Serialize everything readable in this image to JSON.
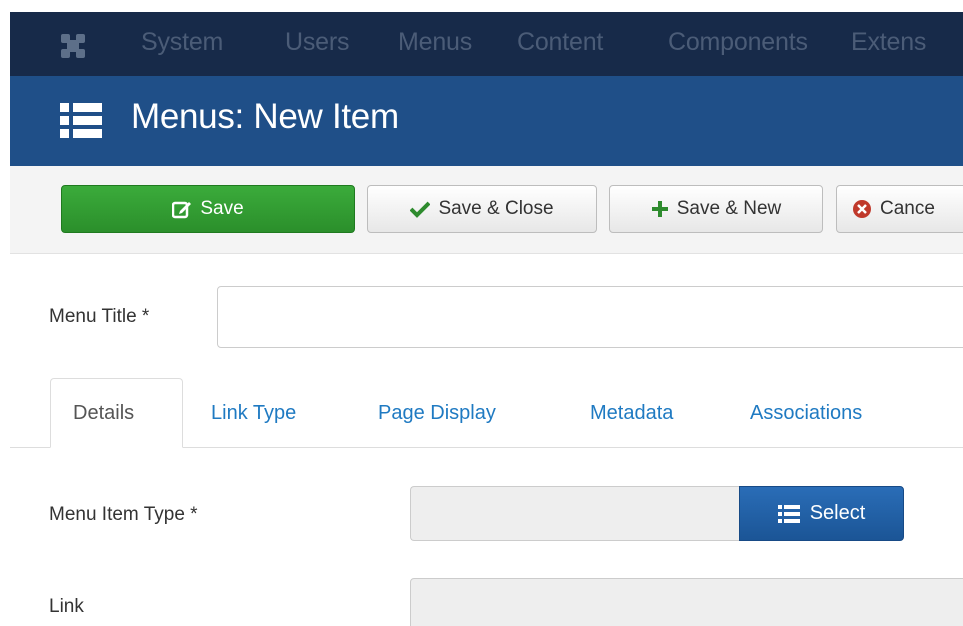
{
  "topnav": {
    "logo_icon": "joomla-logo-icon",
    "items": [
      {
        "label": "System"
      },
      {
        "label": "Users"
      },
      {
        "label": "Menus"
      },
      {
        "label": "Content"
      },
      {
        "label": "Components"
      },
      {
        "label": "Extens"
      }
    ]
  },
  "header": {
    "icon": "list-icon",
    "title": "Menus: New Item"
  },
  "toolbar": {
    "save_label": "Save",
    "save_close_label": "Save & Close",
    "save_new_label": "Save & New",
    "cancel_label": "Cance"
  },
  "form": {
    "menu_title_label": "Menu Title *",
    "menu_title_value": "",
    "tabs": [
      {
        "label": "Details",
        "active": true
      },
      {
        "label": "Link Type"
      },
      {
        "label": "Page Display"
      },
      {
        "label": "Metadata"
      },
      {
        "label": "Associations"
      }
    ],
    "menu_item_type_label": "Menu Item Type *",
    "select_label": "Select",
    "link_label": "Link"
  },
  "colors": {
    "nav_bg": "#172a49",
    "header_bg": "#1f4f88",
    "save_green": "#2f9b2f",
    "select_blue": "#1f5fa6",
    "tab_link": "#1f7ac2"
  }
}
